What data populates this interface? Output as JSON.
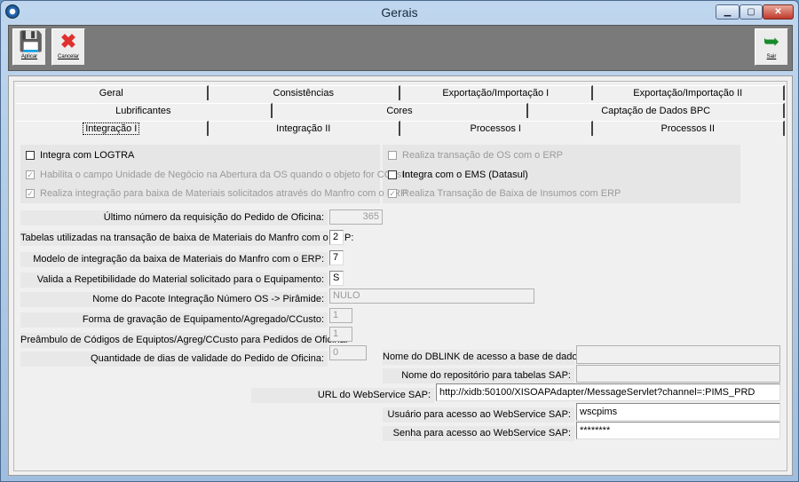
{
  "window": {
    "title": "Gerais"
  },
  "toolbar": {
    "aplicar_label": "Aplicar",
    "cancelar_label": "Cancelar",
    "sair_label": "Sair"
  },
  "tabs": {
    "row1": [
      "Geral",
      "Consistências",
      "Exportação/Importação I",
      "Exportação/Importação II"
    ],
    "row2": [
      "Lubrificantes",
      "Cores",
      "Captação de Dados BPC"
    ],
    "row3": [
      "Integração I",
      "Integração II",
      "Processos I",
      "Processos II"
    ],
    "active": "Integração I"
  },
  "checkboxes": {
    "integra_logtra": {
      "label": "Integra com LOGTRA",
      "checked": false,
      "enabled": true
    },
    "habilita_unidade": {
      "label": "Habilita o campo Unidade de Negócio na Abertura da OS quando o objeto for CCusto",
      "checked": true,
      "enabled": false
    },
    "realiza_integracao": {
      "label": "Realiza integração para baixa de Materiais solicitados através do Manfro com o ERP",
      "checked": true,
      "enabled": false
    },
    "realiza_transacao_os": {
      "label": "Realiza transação de OS com o ERP",
      "checked": false,
      "enabled": false
    },
    "integra_ems": {
      "label": "Integra com o EMS (Datasul)",
      "checked": false,
      "enabled": true
    },
    "realiza_baixa_insumos": {
      "label": "Realiza Transação de Baixa de Insumos com ERP",
      "checked": true,
      "enabled": false
    }
  },
  "fields": {
    "ultimo_numero": {
      "label": "Último número da requisição do Pedido de Oficina:",
      "value": "365"
    },
    "tabelas_utilizadas": {
      "label": "Tabelas utilizadas na transação de baixa de Materiais do Manfro com o ERP:",
      "value": "2"
    },
    "modelo_integracao": {
      "label": "Modelo de integração da baixa de Materiais do Manfro com o ERP:",
      "value": "7"
    },
    "valida_repetibilidade": {
      "label": "Valida a Repetibilidade do Material solicitado para o Equipamento:",
      "value": "S"
    },
    "nome_pacote": {
      "label": "Nome do Pacote Integração Número OS -> Pirâmide:",
      "value": "NULO"
    },
    "forma_gravacao": {
      "label": "Forma de gravação de Equipamento/Agregado/CCusto:",
      "value": "1"
    },
    "preambulo": {
      "label": "Preâmbulo de Códigos de Equiptos/Agreg/CCusto para Pedidos de Oficina:",
      "value": "1"
    },
    "quantidade_dias": {
      "label": "Quantidade de dias de validade do Pedido de Oficina:",
      "value": "0"
    },
    "nome_dblink": {
      "label": "Nome do DBLINK de acesso a base de dados:",
      "value": ""
    },
    "nome_repositorio": {
      "label": "Nome do repositório para tabelas SAP:",
      "value": ""
    },
    "url_webservice": {
      "label": "URL do WebService SAP:",
      "value": "http://xidb:50100/XISOAPAdapter/MessageServlet?channel=:PIMS_PRD"
    },
    "usuario_webservice": {
      "label": "Usuário para acesso ao WebService SAP:",
      "value": "wscpims"
    },
    "senha_webservice": {
      "label": "Senha para acesso ao WebService SAP:",
      "value": "********"
    }
  }
}
